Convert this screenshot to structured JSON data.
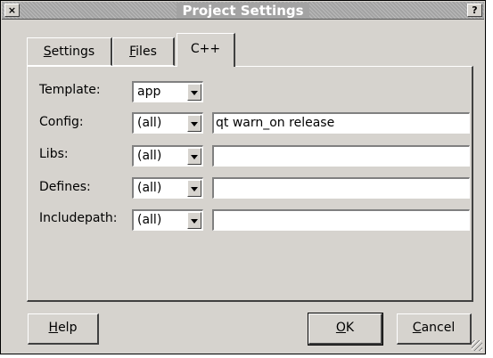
{
  "window": {
    "title": "Project Settings",
    "close_glyph": "×",
    "help_glyph": "?"
  },
  "tabs": [
    {
      "pre": "",
      "accel": "S",
      "post": "ettings",
      "active": false
    },
    {
      "pre": "",
      "accel": "F",
      "post": "iles",
      "active": false
    },
    {
      "pre": "C++",
      "accel": "",
      "post": "",
      "active": true
    }
  ],
  "form": {
    "template": {
      "label": "Template:",
      "value": "app"
    },
    "config": {
      "label": "Config:",
      "scope": "(all)",
      "value": "qt warn_on release"
    },
    "libs": {
      "label": "Libs:",
      "scope": "(all)",
      "value": ""
    },
    "defines": {
      "label": "Defines:",
      "scope": "(all)",
      "value": ""
    },
    "includepath": {
      "label": "Includepath:",
      "scope": "(all)",
      "value": ""
    }
  },
  "buttons": {
    "help": {
      "accel": "H",
      "post": "elp"
    },
    "ok": {
      "accel": "O",
      "post": "K"
    },
    "cancel": {
      "accel": "C",
      "post": "ancel"
    }
  },
  "icons": {
    "close": "close-icon",
    "help": "help-icon",
    "dropdown": "chevron-down-icon",
    "grip": "resize-grip-icon"
  },
  "colors": {
    "face": "#d6d3ce",
    "title_bar": "#a3a3a3",
    "title_text": "#ffffff"
  }
}
